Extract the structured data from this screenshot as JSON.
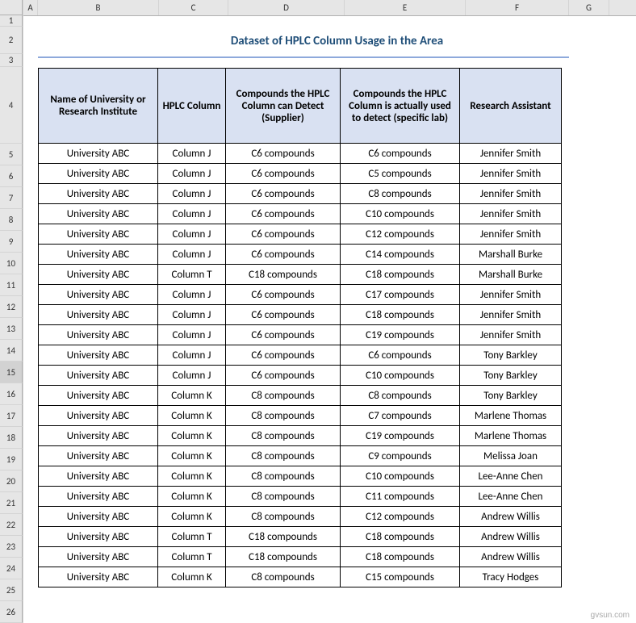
{
  "columns": [
    "A",
    "B",
    "C",
    "D",
    "E",
    "F",
    "G"
  ],
  "rowNumbers": [
    "1",
    "2",
    "3",
    "4",
    "5",
    "6",
    "7",
    "8",
    "9",
    "10",
    "11",
    "12",
    "13",
    "14",
    "15",
    "16",
    "17",
    "18",
    "19",
    "20",
    "21",
    "22",
    "23",
    "24",
    "25",
    "26"
  ],
  "title": "Dataset of HPLC Column Usage in the Area",
  "headers": {
    "university": "Name of University or Research Institute",
    "hplc": "HPLC Column",
    "detect": "Compounds the HPLC Column can Detect (Supplier)",
    "used": "Compounds the HPLC Column is actually used to detect (specific lab)",
    "assistant": "Research Assistant"
  },
  "rows": [
    {
      "u": "University ABC",
      "h": "Column J",
      "d": "C6 compounds",
      "us": "C6 compounds",
      "a": "Jennifer Smith"
    },
    {
      "u": "University ABC",
      "h": "Column J",
      "d": "C6 compounds",
      "us": "C5 compounds",
      "a": "Jennifer Smith"
    },
    {
      "u": "University ABC",
      "h": "Column J",
      "d": "C6 compounds",
      "us": "C8 compounds",
      "a": "Jennifer Smith"
    },
    {
      "u": "University ABC",
      "h": "Column J",
      "d": "C6 compounds",
      "us": "C10 compounds",
      "a": "Jennifer Smith"
    },
    {
      "u": "University ABC",
      "h": "Column J",
      "d": "C6 compounds",
      "us": "C12 compounds",
      "a": "Jennifer Smith"
    },
    {
      "u": "University ABC",
      "h": "Column J",
      "d": "C6 compounds",
      "us": "C14 compounds",
      "a": "Marshall Burke"
    },
    {
      "u": "University ABC",
      "h": "Column T",
      "d": "C18 compounds",
      "us": "C18 compounds",
      "a": "Marshall Burke"
    },
    {
      "u": "University ABC",
      "h": "Column J",
      "d": "C6 compounds",
      "us": "C17 compounds",
      "a": "Jennifer Smith"
    },
    {
      "u": "University ABC",
      "h": "Column J",
      "d": "C6 compounds",
      "us": "C18 compounds",
      "a": "Jennifer Smith"
    },
    {
      "u": "University ABC",
      "h": "Column J",
      "d": "C6 compounds",
      "us": "C19 compounds",
      "a": "Jennifer Smith"
    },
    {
      "u": "University ABC",
      "h": "Column J",
      "d": "C6 compounds",
      "us": "C6 compounds",
      "a": "Tony Barkley"
    },
    {
      "u": "University ABC",
      "h": "Column J",
      "d": "C6 compounds",
      "us": "C10 compounds",
      "a": "Tony Barkley"
    },
    {
      "u": "University ABC",
      "h": "Column K",
      "d": "C8 compounds",
      "us": "C8 compounds",
      "a": "Tony Barkley"
    },
    {
      "u": "University ABC",
      "h": "Column K",
      "d": "C8 compounds",
      "us": "C7 compounds",
      "a": "Marlene Thomas"
    },
    {
      "u": "University ABC",
      "h": "Column K",
      "d": "C8 compounds",
      "us": "C19 compounds",
      "a": "Marlene Thomas"
    },
    {
      "u": "University ABC",
      "h": "Column K",
      "d": "C8 compounds",
      "us": "C9 compounds",
      "a": "Melissa Joan"
    },
    {
      "u": "University ABC",
      "h": "Column K",
      "d": "C8 compounds",
      "us": "C10 compounds",
      "a": "Lee-Anne Chen"
    },
    {
      "u": "University ABC",
      "h": "Column K",
      "d": "C8 compounds",
      "us": "C11 compounds",
      "a": "Lee-Anne Chen"
    },
    {
      "u": "University ABC",
      "h": "Column K",
      "d": "C8 compounds",
      "us": "C12 compounds",
      "a": "Andrew Willis"
    },
    {
      "u": "University ABC",
      "h": "Column T",
      "d": "C18 compounds",
      "us": "C18 compounds",
      "a": "Andrew Willis"
    },
    {
      "u": "University ABC",
      "h": "Column T",
      "d": "C18 compounds",
      "us": "C18 compounds",
      "a": "Andrew Willis"
    },
    {
      "u": "University ABC",
      "h": "Column K",
      "d": "C8 compounds",
      "us": "C15 compounds",
      "a": "Tracy Hodges"
    }
  ],
  "selectedRow": "15",
  "watermark": "gvsun.com"
}
